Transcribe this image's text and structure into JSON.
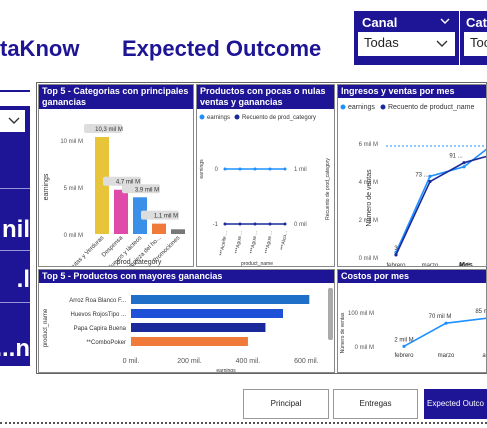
{
  "header": {
    "brand_partial": "taKnow",
    "title": "Expected Outcome"
  },
  "slicers": {
    "canal": {
      "label": "Canal",
      "value": "Todas"
    },
    "categoria": {
      "label": "Cate",
      "value": "Toc"
    }
  },
  "left_panel": {
    "kpi_1": "nil",
    "kpi_2": "l.",
    "kpi_3": "n..."
  },
  "panels": {
    "top5_categorias": {
      "title": "Top 5 - Categorias con principales ganancias",
      "chart_data": {
        "type": "bar",
        "categories": [
          "Frutas y Verduras",
          "Despensa",
          "Huevos y lácteos",
          "Limpieza del ho...",
          "Promociones"
        ],
        "values": [
          10.3,
          4.7,
          3.9,
          1.1,
          0.5
        ],
        "data_labels": [
          "10,3 mil M",
          "4,7 mil M",
          "3,9 mil M",
          "1,1 mil M",
          ""
        ],
        "ylabel": "earnings",
        "xlabel": "prod_category",
        "yticks": [
          "0 mil M",
          "5 mil M",
          "10 mil M"
        ],
        "colors": [
          "#e8c43a",
          "#e04aa8",
          "#3a8fe8",
          "#f07a3a",
          "#777777"
        ]
      }
    },
    "productos_pocas": {
      "title": "Productos con pocas o nulas ventas y ganancias",
      "legend": [
        "earnings",
        "Recuento de prod_category"
      ],
      "chart_data": {
        "type": "line",
        "categories": [
          "***Aceite ...",
          "***Agua ...",
          "***Agua ...",
          "***Agua ...",
          "***Alcu..."
        ],
        "series": [
          {
            "name": "earnings",
            "values": [
              0,
              0,
              0,
              0,
              0
            ]
          },
          {
            "name": "Recuento de prod_category",
            "values": [
              1,
              1,
              1,
              1,
              1
            ]
          }
        ],
        "ylabel_left": "earnings",
        "ylabel_right": "Recuento de prod_category",
        "xlabel": "product_name",
        "yticks_left": [
          "0",
          "-1"
        ],
        "yticks_right": [
          "1 mil",
          "0 mil"
        ]
      }
    },
    "ingresos_ventas": {
      "title": "Ingresos y ventas por mes",
      "legend": [
        "earnings",
        "Recuento de product_name"
      ],
      "chart_data": {
        "type": "line",
        "categories": [
          "febrero",
          "marzo",
          "abril",
          "mayo"
        ],
        "series": [
          {
            "name": "earnings",
            "values": [
              0.3,
              4.3,
              4.8,
              6.2
            ]
          },
          {
            "name": "Recuento de product_name",
            "values": [
              3,
              73,
              91,
              100
            ]
          }
        ],
        "data_labels": [
          "3",
          "73 ...",
          "91 ..."
        ],
        "ylabel": "Número de ventas",
        "xlabel": "Mes",
        "yticks": [
          "0 mil M",
          "2 mil M",
          "4 mil M",
          "6 mil M"
        ]
      }
    },
    "top5_productos": {
      "title": "Top 5 - Productos con mayores ganancias",
      "chart_data": {
        "type": "bar",
        "categories": [
          "Arroz Roa Blanco F...",
          "Huevos RojosTipo ...",
          "Papa Capira Buena",
          "**ComboPoker"
        ],
        "values": [
          610,
          520,
          460,
          400
        ],
        "ylabel": "product_name",
        "xlabel": "earnings",
        "xticks": [
          "0 mil.",
          "200 mil.",
          "400 mil.",
          "600 mil."
        ],
        "colors": [
          "#1f6fc8",
          "#1e50d8",
          "#1a2a9a",
          "#f07a3a"
        ]
      }
    },
    "costos_mes": {
      "title": "Costos por mes",
      "chart_data": {
        "type": "line",
        "categories": [
          "febrero",
          "marzo",
          "abril"
        ],
        "values": [
          2,
          70,
          85
        ],
        "data_labels": [
          "2 mil M",
          "70 mil M",
          "85 m"
        ],
        "ylabel": "Número de ventas",
        "yticks": [
          "0 mil M",
          "100 mil M"
        ]
      }
    }
  },
  "nav": {
    "principal": "Principal",
    "entregas": "Entregas",
    "expected": "Expected Outco"
  },
  "colors": {
    "brand": "#1e1496",
    "line_light": "#1e90ff",
    "line_dark": "#1a2a9a"
  }
}
